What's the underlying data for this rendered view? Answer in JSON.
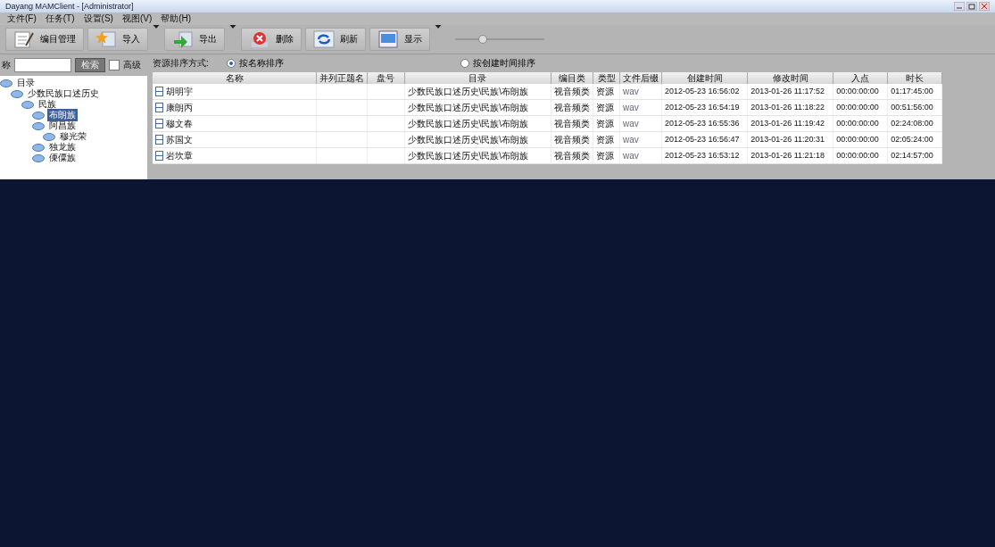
{
  "window": {
    "title": "Dayang MAMClient - [Administrator]"
  },
  "menu": [
    "文件(F)",
    "任务(T)",
    "设置(S)",
    "视图(V)",
    "帮助(H)"
  ],
  "toolbar": [
    {
      "label": "编目管理",
      "kind": "catalog",
      "dropdown": false
    },
    {
      "label": "导入",
      "kind": "import",
      "dropdown": true
    },
    {
      "label": "导出",
      "kind": "export",
      "dropdown": true
    },
    {
      "label": "删除",
      "kind": "delete",
      "dropdown": false
    },
    {
      "label": "刷新",
      "kind": "refresh",
      "dropdown": false
    },
    {
      "label": "显示",
      "kind": "display",
      "dropdown": true
    }
  ],
  "zoom_slider": {
    "level": 0.3
  },
  "search": {
    "label": "称",
    "button": "检索",
    "advanced": {
      "label": "高级",
      "checked": false
    }
  },
  "tree": [
    {
      "label": "目录",
      "selected": false,
      "children": [
        {
          "label": "少数民族口述历史",
          "selected": false,
          "children": [
            {
              "label": "民族",
              "selected": false,
              "children": [
                {
                  "label": "布朗族",
                  "selected": true
                },
                {
                  "label": "阿昌族",
                  "selected": false,
                  "children": [
                    {
                      "label": "穆光荣",
                      "selected": false
                    }
                  ]
                },
                {
                  "label": "独龙族",
                  "selected": false
                },
                {
                  "label": "傈僳族",
                  "selected": false
                }
              ]
            }
          ]
        }
      ]
    }
  ],
  "sort": {
    "label": "资源排序方式:",
    "options": [
      {
        "label": "按名称排序",
        "selected": true
      },
      {
        "label": "按创建时间排序",
        "selected": false
      }
    ]
  },
  "table": {
    "columns": [
      "名称",
      "并列正题名",
      "盘号",
      "目录",
      "编目类",
      "类型",
      "文件后缀",
      "创建时间",
      "修改时间",
      "入点",
      "时长"
    ],
    "rows": [
      [
        "胡明宇",
        "",
        "",
        "少数民族口述历史\\民族\\布朗族",
        "视音频类",
        "资源",
        "wav",
        "2012-05-23 16:56:02",
        "2013-01-26 11:17:52",
        "00:00:00:00",
        "01:17:45:00"
      ],
      [
        "康朗丙",
        "",
        "",
        "少数民族口述历史\\民族\\布朗族",
        "视音频类",
        "资源",
        "wav",
        "2012-05-23 16:54:19",
        "2013-01-26 11:18:22",
        "00:00:00:00",
        "00:51:56:00"
      ],
      [
        "穆文春",
        "",
        "",
        "少数民族口述历史\\民族\\布朗族",
        "视音频类",
        "资源",
        "wav",
        "2012-05-23 16:55:36",
        "2013-01-26 11:19:42",
        "00:00:00:00",
        "02:24:08:00"
      ],
      [
        "苏国文",
        "",
        "",
        "少数民族口述历史\\民族\\布朗族",
        "视音频类",
        "资源",
        "wav",
        "2012-05-23 16:56:47",
        "2013-01-26 11:20:31",
        "00:00:00:00",
        "02:05:24:00"
      ],
      [
        "岩坎章",
        "",
        "",
        "少数民族口述历史\\民族\\布朗族",
        "视音频类",
        "资源",
        "wav",
        "2012-05-23 16:53:12",
        "2013-01-26 11:21:18",
        "00:00:00:00",
        "02:14:57:00"
      ]
    ]
  }
}
